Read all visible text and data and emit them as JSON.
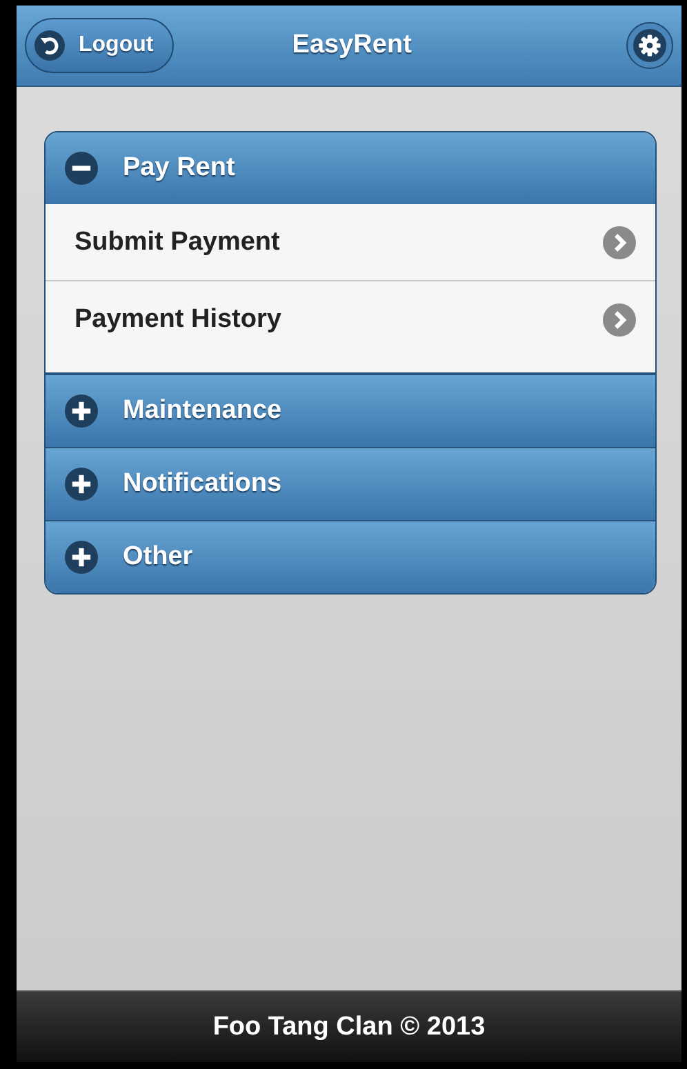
{
  "header": {
    "title": "EasyRent",
    "logout_button": "Logout"
  },
  "sections": [
    {
      "label": "Pay Rent",
      "expanded": true,
      "items": [
        {
          "label": "Submit Payment"
        },
        {
          "label": "Payment History"
        }
      ]
    },
    {
      "label": "Maintenance",
      "expanded": false
    },
    {
      "label": "Notifications",
      "expanded": false
    },
    {
      "label": "Other",
      "expanded": false
    }
  ],
  "footer": {
    "text": "Foo Tang Clan © 2013"
  }
}
